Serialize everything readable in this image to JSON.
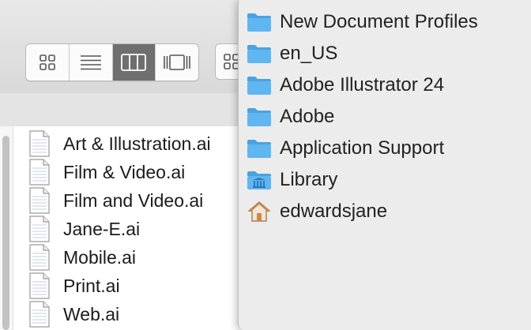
{
  "toolbar": {
    "view_buttons": [
      {
        "id": "icon-view",
        "icon": "grid-icon",
        "active": false
      },
      {
        "id": "list-view",
        "icon": "list-icon",
        "active": false
      },
      {
        "id": "column-view",
        "icon": "columns-icon",
        "active": true
      },
      {
        "id": "gallery-view",
        "icon": "gallery-icon",
        "active": false
      }
    ],
    "group_button": {
      "icon": "group-icon"
    }
  },
  "files": [
    {
      "name": "Art & Illustration.ai",
      "icon": "document-icon"
    },
    {
      "name": "Film & Video.ai",
      "icon": "document-icon"
    },
    {
      "name": "Film and Video.ai",
      "icon": "document-icon"
    },
    {
      "name": "Jane-E.ai",
      "icon": "document-icon"
    },
    {
      "name": "Mobile.ai",
      "icon": "document-icon"
    },
    {
      "name": "Print.ai",
      "icon": "document-icon"
    },
    {
      "name": "Web.ai",
      "icon": "document-icon"
    }
  ],
  "path_menu": {
    "items": [
      {
        "label": "New Document Profiles",
        "icon": "folder-icon"
      },
      {
        "label": "en_US",
        "icon": "folder-icon"
      },
      {
        "label": "Adobe Illustrator 24",
        "icon": "folder-icon"
      },
      {
        "label": "Adobe",
        "icon": "folder-icon"
      },
      {
        "label": "Application Support",
        "icon": "folder-icon"
      },
      {
        "label": "Library",
        "icon": "library-folder-icon"
      },
      {
        "label": "edwardsjane",
        "icon": "home-icon"
      }
    ]
  },
  "colors": {
    "folder": "#5fb6f0",
    "folder_tab": "#4aa3e0",
    "active_segment": "#6f6f6f",
    "home": "#c98a52"
  }
}
